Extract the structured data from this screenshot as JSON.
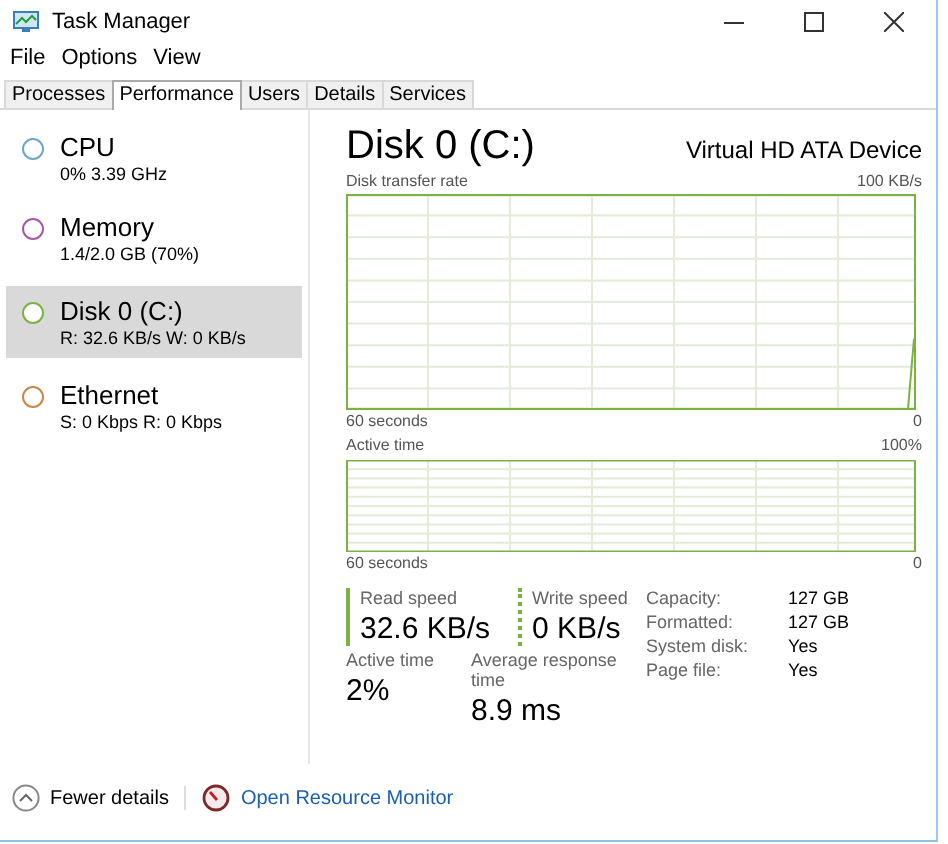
{
  "window": {
    "title": "Task Manager"
  },
  "menu": [
    "File",
    "Options",
    "View"
  ],
  "tabs": [
    {
      "label": "Processes",
      "selected": false
    },
    {
      "label": "Performance",
      "selected": true
    },
    {
      "label": "Users",
      "selected": false
    },
    {
      "label": "Details",
      "selected": false
    },
    {
      "label": "Services",
      "selected": false
    }
  ],
  "sidebar": {
    "items": [
      {
        "name": "CPU",
        "detail": "0% 3.39 GHz",
        "color": "#6ea6c8",
        "selected": false
      },
      {
        "name": "Memory",
        "detail": "1.4/2.0 GB (70%)",
        "color": "#a45ca8",
        "selected": false
      },
      {
        "name": "Disk 0 (C:)",
        "detail": "R: 32.6 KB/s W: 0 KB/s",
        "color": "#7cb244",
        "selected": true
      },
      {
        "name": "Ethernet",
        "detail": "S: 0 Kbps R: 0 Kbps",
        "color": "#c8884a",
        "selected": false
      }
    ]
  },
  "panel": {
    "title": "Disk 0 (C:)",
    "device": "Virtual HD ATA Device",
    "graphs": [
      {
        "label": "Disk transfer rate",
        "max": "100 KB/s",
        "span": "60 seconds",
        "min": "0"
      },
      {
        "label": "Active time",
        "max": "100%",
        "span": "60 seconds",
        "min": "0"
      }
    ],
    "speeds": [
      {
        "kind": "solid",
        "label": "Read speed",
        "value": "32.6 KB/s"
      },
      {
        "kind": "dotted",
        "label": "Write speed",
        "value": "0 KB/s"
      }
    ],
    "stats": [
      {
        "label": "Active time",
        "value": "2%"
      },
      {
        "label": "Average response time",
        "value": "8.9 ms"
      }
    ],
    "properties": [
      {
        "label": "Capacity:",
        "value": "127 GB"
      },
      {
        "label": "Formatted:",
        "value": "127 GB"
      },
      {
        "label": "System disk:",
        "value": "Yes"
      },
      {
        "label": "Page file:",
        "value": "Yes"
      }
    ]
  },
  "footer": {
    "fewer_details": "Fewer details",
    "link": "Open Resource Monitor"
  }
}
